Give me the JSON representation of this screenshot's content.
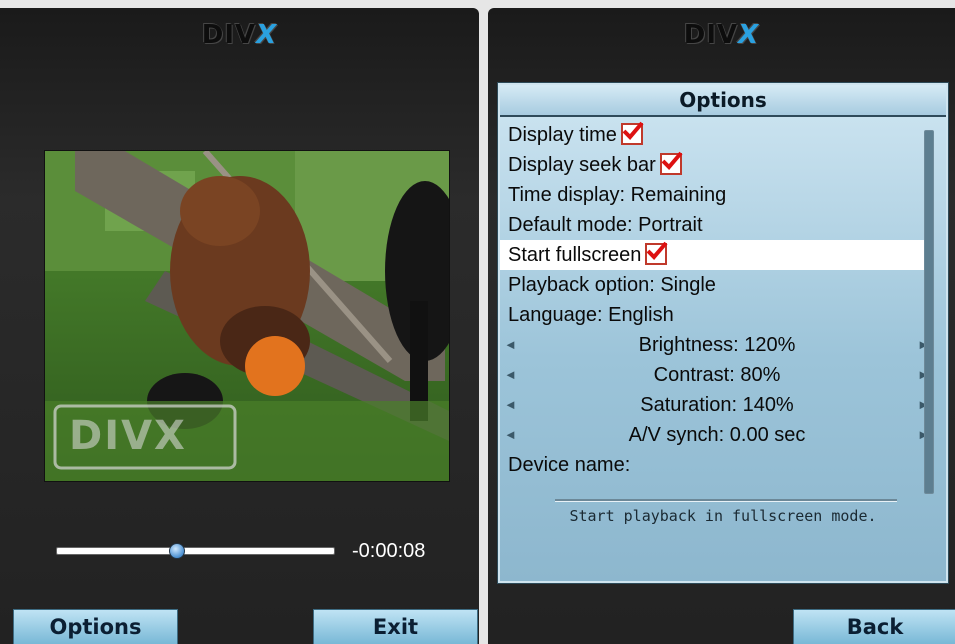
{
  "logo": {
    "text": "DIV",
    "x": "X"
  },
  "player": {
    "time_remaining": "-0:00:08",
    "progress": 0.43,
    "watermark": "DIVX"
  },
  "softkeys": {
    "left": "Options",
    "exit": "Exit",
    "back": "Back"
  },
  "options": {
    "title": "Options",
    "items": [
      {
        "label": "Display time",
        "checked": true
      },
      {
        "label": "Display seek bar",
        "checked": true
      },
      {
        "label": "Time display: Remaining"
      },
      {
        "label": "Default mode: Portrait"
      },
      {
        "label": "Start fullscreen",
        "checked": true,
        "selected": true
      },
      {
        "label": "Playback option: Single"
      },
      {
        "label": "Language: English"
      },
      {
        "label": "Brightness: 120%"
      },
      {
        "label": "Contrast: 80%"
      },
      {
        "label": "Saturation: 140%"
      },
      {
        "label": "A/V synch:  0.00 sec"
      },
      {
        "label": "Device name:"
      }
    ],
    "hint": "Start playback in fullscreen mode."
  },
  "colors": {
    "accent": "#2aa1e0",
    "softkey": "#9ccde4",
    "check": "#c0392b"
  }
}
